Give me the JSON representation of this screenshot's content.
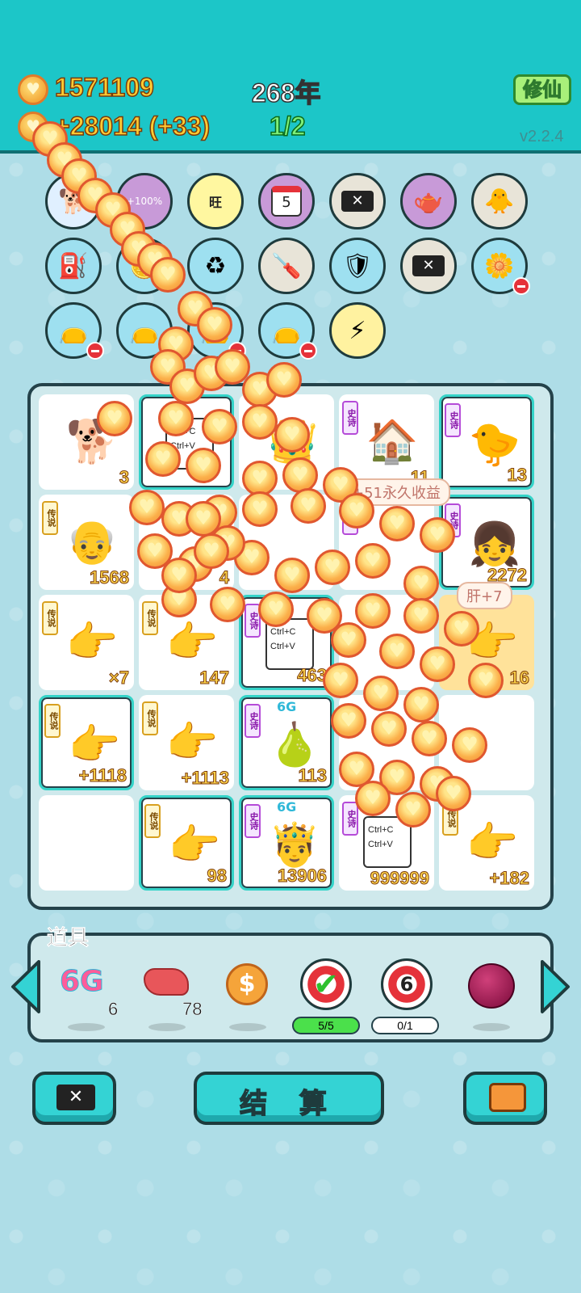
{
  "header": {
    "coins": "1571109",
    "income": "+28014 (+33)",
    "year": "268年",
    "stage": "1/2",
    "xiuxian_label": "修仙",
    "version": "v2.2.4"
  },
  "icons_row1": [
    {
      "name": "dog-cart-icon"
    },
    {
      "name": "bucket-icon",
      "label": "+100%"
    },
    {
      "name": "wang-grid-icon",
      "label": "旺"
    },
    {
      "name": "calendar-icon",
      "label": "5"
    },
    {
      "name": "ticket-x-icon"
    },
    {
      "name": "gravy-boat-icon"
    },
    {
      "name": "chick-egg-icon"
    }
  ],
  "icons_row2": [
    {
      "name": "pump-icon"
    },
    {
      "name": "coin-stack-icon"
    },
    {
      "name": "recycle-bag-icon"
    },
    {
      "name": "screwdriver-icon"
    },
    {
      "name": "shield-wrench-icon"
    },
    {
      "name": "ticket-x-icon"
    },
    {
      "name": "flower-pot-icon"
    }
  ],
  "icons_row3": [
    {
      "name": "bag-icon"
    },
    {
      "name": "bag-icon"
    },
    {
      "name": "bag-icon"
    },
    {
      "name": "bag-icon"
    },
    {
      "name": "lightning-icon"
    }
  ],
  "board": {
    "tiles": [
      {
        "row": 0,
        "col": 0,
        "tag": "",
        "count": "3",
        "art": "husky"
      },
      {
        "row": 0,
        "col": 1,
        "tag": "",
        "count": "",
        "art": "ctrl"
      },
      {
        "row": 0,
        "col": 2,
        "tag": "",
        "count": "",
        "art": "crown"
      },
      {
        "row": 0,
        "col": 3,
        "tag": "史诗",
        "count": "11",
        "art": "rabbit-house"
      },
      {
        "row": 0,
        "col": 4,
        "tag": "史诗",
        "count": "13",
        "art": "chick-hair"
      },
      {
        "row": 1,
        "col": 0,
        "tag": "传说",
        "count": "1568",
        "art": "old-man"
      },
      {
        "row": 1,
        "col": 1,
        "tag": "",
        "count": "4",
        "art": ""
      },
      {
        "row": 1,
        "col": 2,
        "tag": "",
        "count": "",
        "art": ""
      },
      {
        "row": 1,
        "col": 3,
        "tag": "史诗",
        "count": "",
        "art": ""
      },
      {
        "row": 1,
        "col": 4,
        "tag": "史诗",
        "count": "2272",
        "art": "girl"
      },
      {
        "row": 2,
        "col": 0,
        "tag": "传说",
        "count": "×7",
        "art": "hand"
      },
      {
        "row": 2,
        "col": 1,
        "tag": "传说",
        "count": "147",
        "art": "hand"
      },
      {
        "row": 2,
        "col": 2,
        "tag": "史诗",
        "count": "463",
        "art": "ctrl"
      },
      {
        "row": 2,
        "col": 3,
        "tag": "",
        "count": "",
        "art": ""
      },
      {
        "row": 2,
        "col": 4,
        "tag": "",
        "count": "16",
        "art": "hand"
      },
      {
        "row": 3,
        "col": 0,
        "tag": "传说",
        "count": "+1118",
        "art": "hand"
      },
      {
        "row": 3,
        "col": 1,
        "tag": "传说",
        "count": "+1113",
        "art": "hand"
      },
      {
        "row": 3,
        "col": 2,
        "tag": "史诗",
        "count": "113",
        "art": "pear",
        "badge": "6G"
      },
      {
        "row": 3,
        "col": 3,
        "tag": "",
        "count": "",
        "art": ""
      },
      {
        "row": 3,
        "col": 4,
        "tag": "",
        "count": "",
        "art": ""
      },
      {
        "row": 4,
        "col": 0,
        "tag": "",
        "count": "",
        "art": ""
      },
      {
        "row": 4,
        "col": 1,
        "tag": "传说",
        "count": "98",
        "art": "hand"
      },
      {
        "row": 4,
        "col": 2,
        "tag": "史诗",
        "count": "13906",
        "art": "king",
        "badge": "6G"
      },
      {
        "row": 4,
        "col": 3,
        "tag": "史诗",
        "count": "999999",
        "art": "ctrl-crown"
      },
      {
        "row": 4,
        "col": 4,
        "tag": "传说",
        "count": "+182",
        "art": "hand"
      }
    ],
    "bubble_income": "+51永久收益",
    "bubble_liver": "肝+7",
    "ctrl_c": "Ctrl+C",
    "ctrl_v": "Ctrl+V"
  },
  "items": {
    "title": "道具",
    "list": [
      {
        "name": "6g-item",
        "label": "6G",
        "count": "6"
      },
      {
        "name": "liver-item",
        "count": "78"
      },
      {
        "name": "dollar-coin-item",
        "count": ""
      },
      {
        "name": "check-target-item",
        "progress": "5/5"
      },
      {
        "name": "target-six-item",
        "label": "6",
        "progress": "0/1"
      },
      {
        "name": "lychee-item",
        "count": ""
      }
    ]
  },
  "buttons": {
    "settle": "结 算"
  },
  "colors": {
    "header": "#1cc6c8",
    "gold": "#ffcc33",
    "accent_green": "#7ef07a"
  }
}
